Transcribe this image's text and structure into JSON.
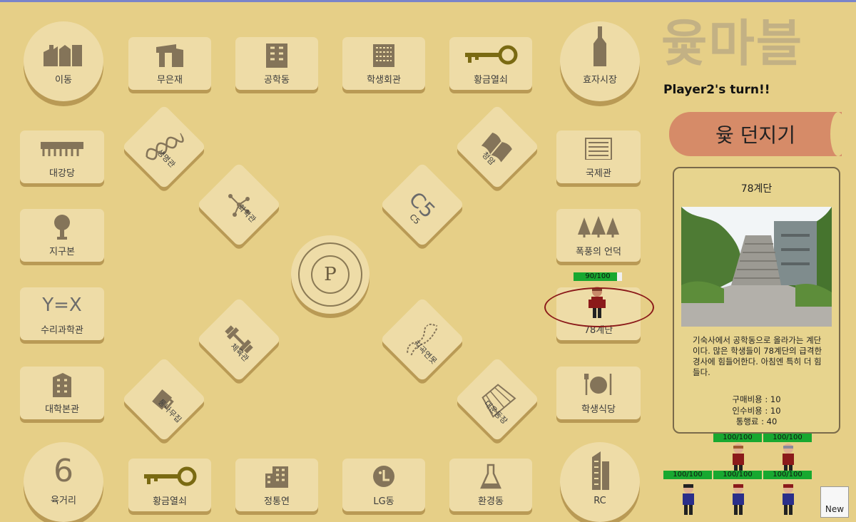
{
  "game": {
    "title": "윷마블",
    "turn_text": "Player2's turn!!",
    "roll_button": "윷 던지기",
    "new_button": "New"
  },
  "corners": {
    "top_left": "이동",
    "top_right": "효자시장",
    "bottom_left": "육거리",
    "bottom_left_number": "6",
    "bottom_right": "RC"
  },
  "top_row": [
    "무은재",
    "공학동",
    "학생회관",
    "황금열쇠"
  ],
  "bottom_row": [
    "황금열쇠",
    "정통연",
    "LG동",
    "환경동"
  ],
  "left_col": [
    "대강당",
    "지구본",
    "수리과학관",
    "대학본관"
  ],
  "left_col_icon_text": {
    "math": "Y=X"
  },
  "right_col": [
    "국제관",
    "폭풍의 언덕",
    "78계단",
    "학생식당"
  ],
  "diagonals": {
    "nw_outer": "생명관",
    "nw_inner": "화학관",
    "ne_outer": "청암",
    "ne_inner": "C5",
    "ne_inner_icon": "C5",
    "sw_inner": "체육관",
    "sw_outer": "통나무집",
    "se_inner": "지곡연못",
    "se_outer": "대운동장"
  },
  "tile_hp": "90/100",
  "tile_hp_fraction": 0.9,
  "info_card": {
    "name": "78계단",
    "description": "기숙사에서 공학동으로 올라가는 계단이다. 많은 학생들이 78계단의 급격한 경사에 힘들어한다. 아침엔 특히 더 힘들다.",
    "purchase_cost": "구매비용 : 10",
    "takeover_cost": "인수비용 : 10",
    "toll": "통행료 : 40"
  },
  "players_hp": {
    "row1": [
      "100/100",
      "100/100"
    ],
    "row2": [
      "100/100",
      "100/100",
      "100/100"
    ]
  },
  "colors": {
    "background": "#e6cf87",
    "tile": "#eedca7",
    "roll_button": "#d68b68",
    "hp_bar": "#18a830",
    "highlight_ring": "#8b1a1a"
  }
}
